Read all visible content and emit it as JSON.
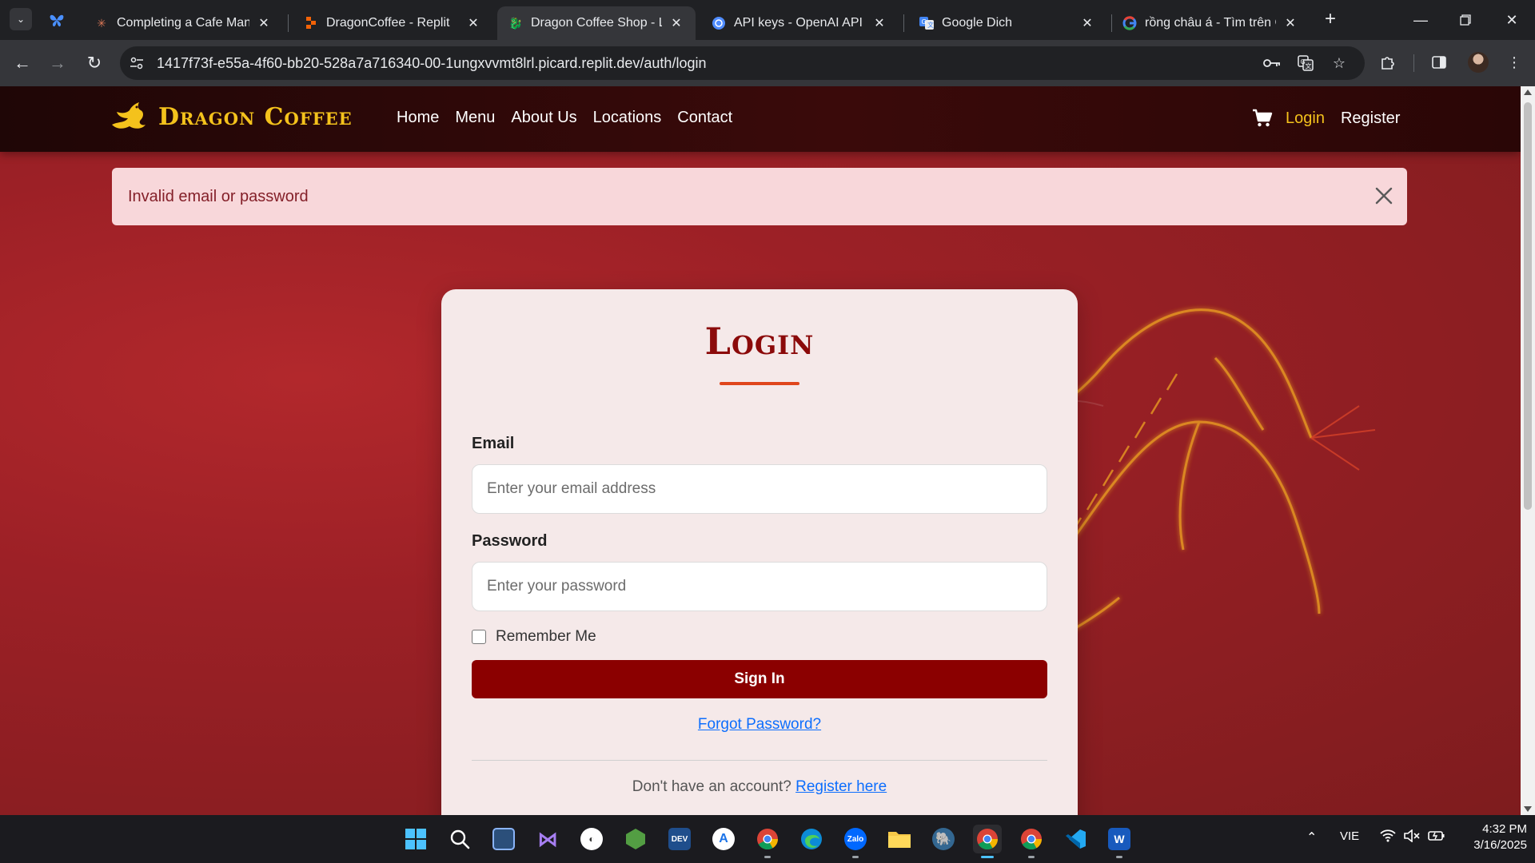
{
  "browser": {
    "tabs": [
      {
        "title": "Completing a Cafe Manag",
        "active": false
      },
      {
        "title": "DragonCoffee - Replit",
        "active": false
      },
      {
        "title": "Dragon Coffee Shop - Lo",
        "active": true
      },
      {
        "title": "API keys - OpenAI API",
        "active": false
      },
      {
        "title": "Google Dich",
        "active": false
      },
      {
        "title": "rồng châu á - Tìm trên Go",
        "active": false
      }
    ],
    "url": "1417f73f-e55a-4f60-bb20-528a7a716340-00-1ungxvvmt8lrl.picard.replit.dev/auth/login"
  },
  "site": {
    "brand_name": "Dragon Coffee",
    "nav": [
      "Home",
      "Menu",
      "About Us",
      "Locations",
      "Contact"
    ],
    "auth": {
      "login": "Login",
      "register": "Register"
    },
    "brand_color": "#f4c21c"
  },
  "alert": {
    "message": "Invalid email or password"
  },
  "login_form": {
    "title": "Login",
    "email_label": "Email",
    "email_placeholder": "Enter your email address",
    "email_value": "",
    "password_label": "Password",
    "password_placeholder": "Enter your password",
    "password_value": "",
    "remember_label": "Remember Me",
    "remember_checked": false,
    "submit_label": "Sign In",
    "forgot_label": "Forgot Password?",
    "no_account_text": "Don't have an account?",
    "register_link": "Register here",
    "submit_color": "#8b0000"
  },
  "taskbar": {
    "apps": [
      "windows-start",
      "search",
      "task-view",
      "visual-studio",
      "github-desktop",
      "node-js",
      "dev-tools",
      "app-installer",
      "chrome",
      "edge",
      "zalo",
      "file-explorer",
      "postgresql",
      "chrome-active",
      "chrome-profile",
      "vs-code",
      "word"
    ],
    "language": "VIE",
    "time": "4:32 PM",
    "date": "3/16/2025"
  }
}
